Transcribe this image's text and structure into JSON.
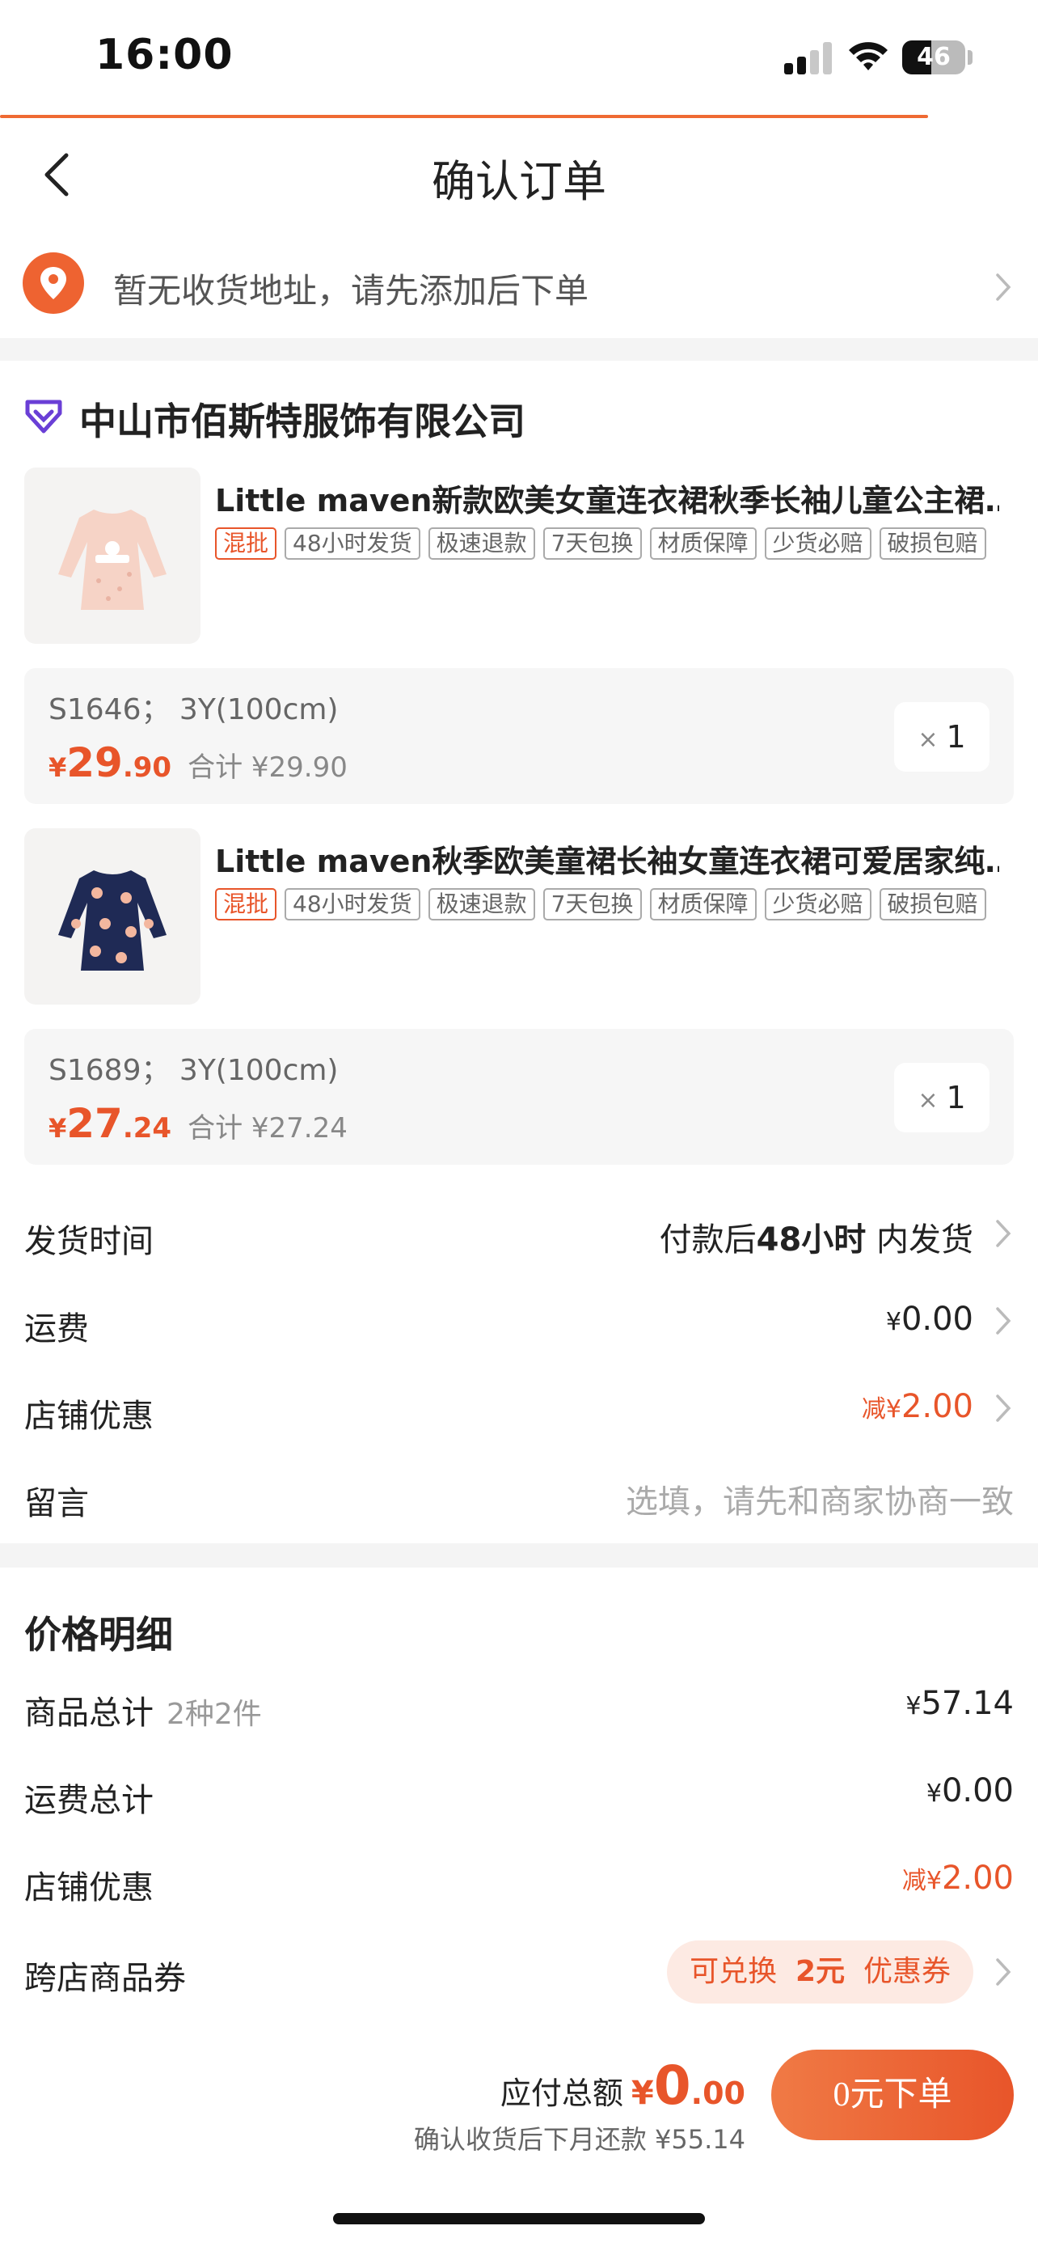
{
  "status_bar": {
    "time": "16:00",
    "battery": "46"
  },
  "nav": {
    "title": "确认订单"
  },
  "address": {
    "text": "暂无收货地址，请先添加后下单"
  },
  "shop": {
    "name": "中山市佰斯特服饰有限公司"
  },
  "products": [
    {
      "name": "Little maven新款欧美女童连衣裙秋季长袖儿童公主裙…",
      "tags": [
        "混批",
        "48小时发货",
        "极速退款",
        "7天包换",
        "材质保障",
        "少货必赔",
        "破损包赔"
      ],
      "spec": "S1646； 3Y(100cm)",
      "currency": "¥",
      "price_int": "29",
      "price_dec": ".90",
      "total": "合计 ¥29.90",
      "qty_x": "×",
      "qty": "1"
    },
    {
      "name": "Little maven秋季欧美童裙长袖女童连衣裙可爱居家纯…",
      "tags": [
        "混批",
        "48小时发货",
        "极速退款",
        "7天包换",
        "材质保障",
        "少货必赔",
        "破损包赔"
      ],
      "spec": "S1689； 3Y(100cm)",
      "currency": "¥",
      "price_int": "27",
      "price_dec": ".24",
      "total": "合计 ¥27.24",
      "qty_x": "×",
      "qty": "1"
    }
  ],
  "order_info": {
    "ship_time": {
      "label": "发货时间",
      "prefix": "付款后",
      "hours": "48小时",
      "suffix": "内发货"
    },
    "freight": {
      "label": "运费",
      "currency": "¥",
      "value": "0.00"
    },
    "shop_discount": {
      "label": "店铺优惠",
      "prefix": "减",
      "currency": "¥",
      "value": "2.00"
    },
    "message": {
      "label": "留言",
      "placeholder": "选填，请先和商家协商一致"
    }
  },
  "price_detail": {
    "title": "价格明细",
    "goods_total": {
      "label": "商品总计",
      "sub": "2种2件",
      "currency": "¥",
      "value": "57.14"
    },
    "freight_total": {
      "label": "运费总计",
      "currency": "¥",
      "value": "0.00"
    },
    "shop_discount": {
      "label": "店铺优惠",
      "prefix": "减",
      "currency": "¥",
      "value": "2.00"
    },
    "cross_coupon": {
      "label": "跨店商品券",
      "pre": "可兑换",
      "amount": "2元",
      "post": "优惠券"
    }
  },
  "bottom_bar": {
    "due_label": "应付总额",
    "currency": "¥",
    "due_int": "0",
    "due_dec": ".00",
    "repay_text": "确认收货后下月还款 ¥55.14",
    "submit_label": "0元下单"
  },
  "colors": {
    "accent": "#e8552a",
    "gap": "#f4f4f4",
    "brand_purple": "#6a3fd6"
  }
}
